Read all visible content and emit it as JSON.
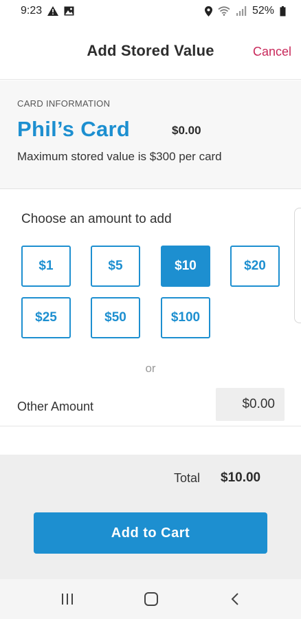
{
  "status_bar": {
    "time": "9:23",
    "battery": "52%",
    "icons": [
      "warning-icon",
      "image-icon",
      "location-icon",
      "wifi-icon",
      "signal-icon",
      "battery-icon"
    ]
  },
  "header": {
    "title": "Add Stored Value",
    "cancel_label": "Cancel"
  },
  "card_info": {
    "section_label": "CARD INFORMATION",
    "card_name": "Phil’s Card",
    "balance": "$0.00",
    "note": "Maximum stored value is $300 per card"
  },
  "amounts": {
    "prompt": "Choose an amount to add",
    "options": [
      "$1",
      "$5",
      "$10",
      "$20",
      "$25",
      "$50",
      "$100"
    ],
    "selected": "$10",
    "or_text": "or",
    "other_label": "Other Amount",
    "other_value": "$0.00"
  },
  "summary": {
    "total_label": "Total",
    "total_value": "$10.00",
    "add_to_cart_label": "Add to Cart"
  },
  "nav_bar": {
    "icons": [
      "recent-apps-icon",
      "home-icon",
      "back-icon"
    ]
  },
  "colors": {
    "accent": "#1d8fd0",
    "cancel": "#c8285a",
    "panel": "#eeeeee"
  }
}
